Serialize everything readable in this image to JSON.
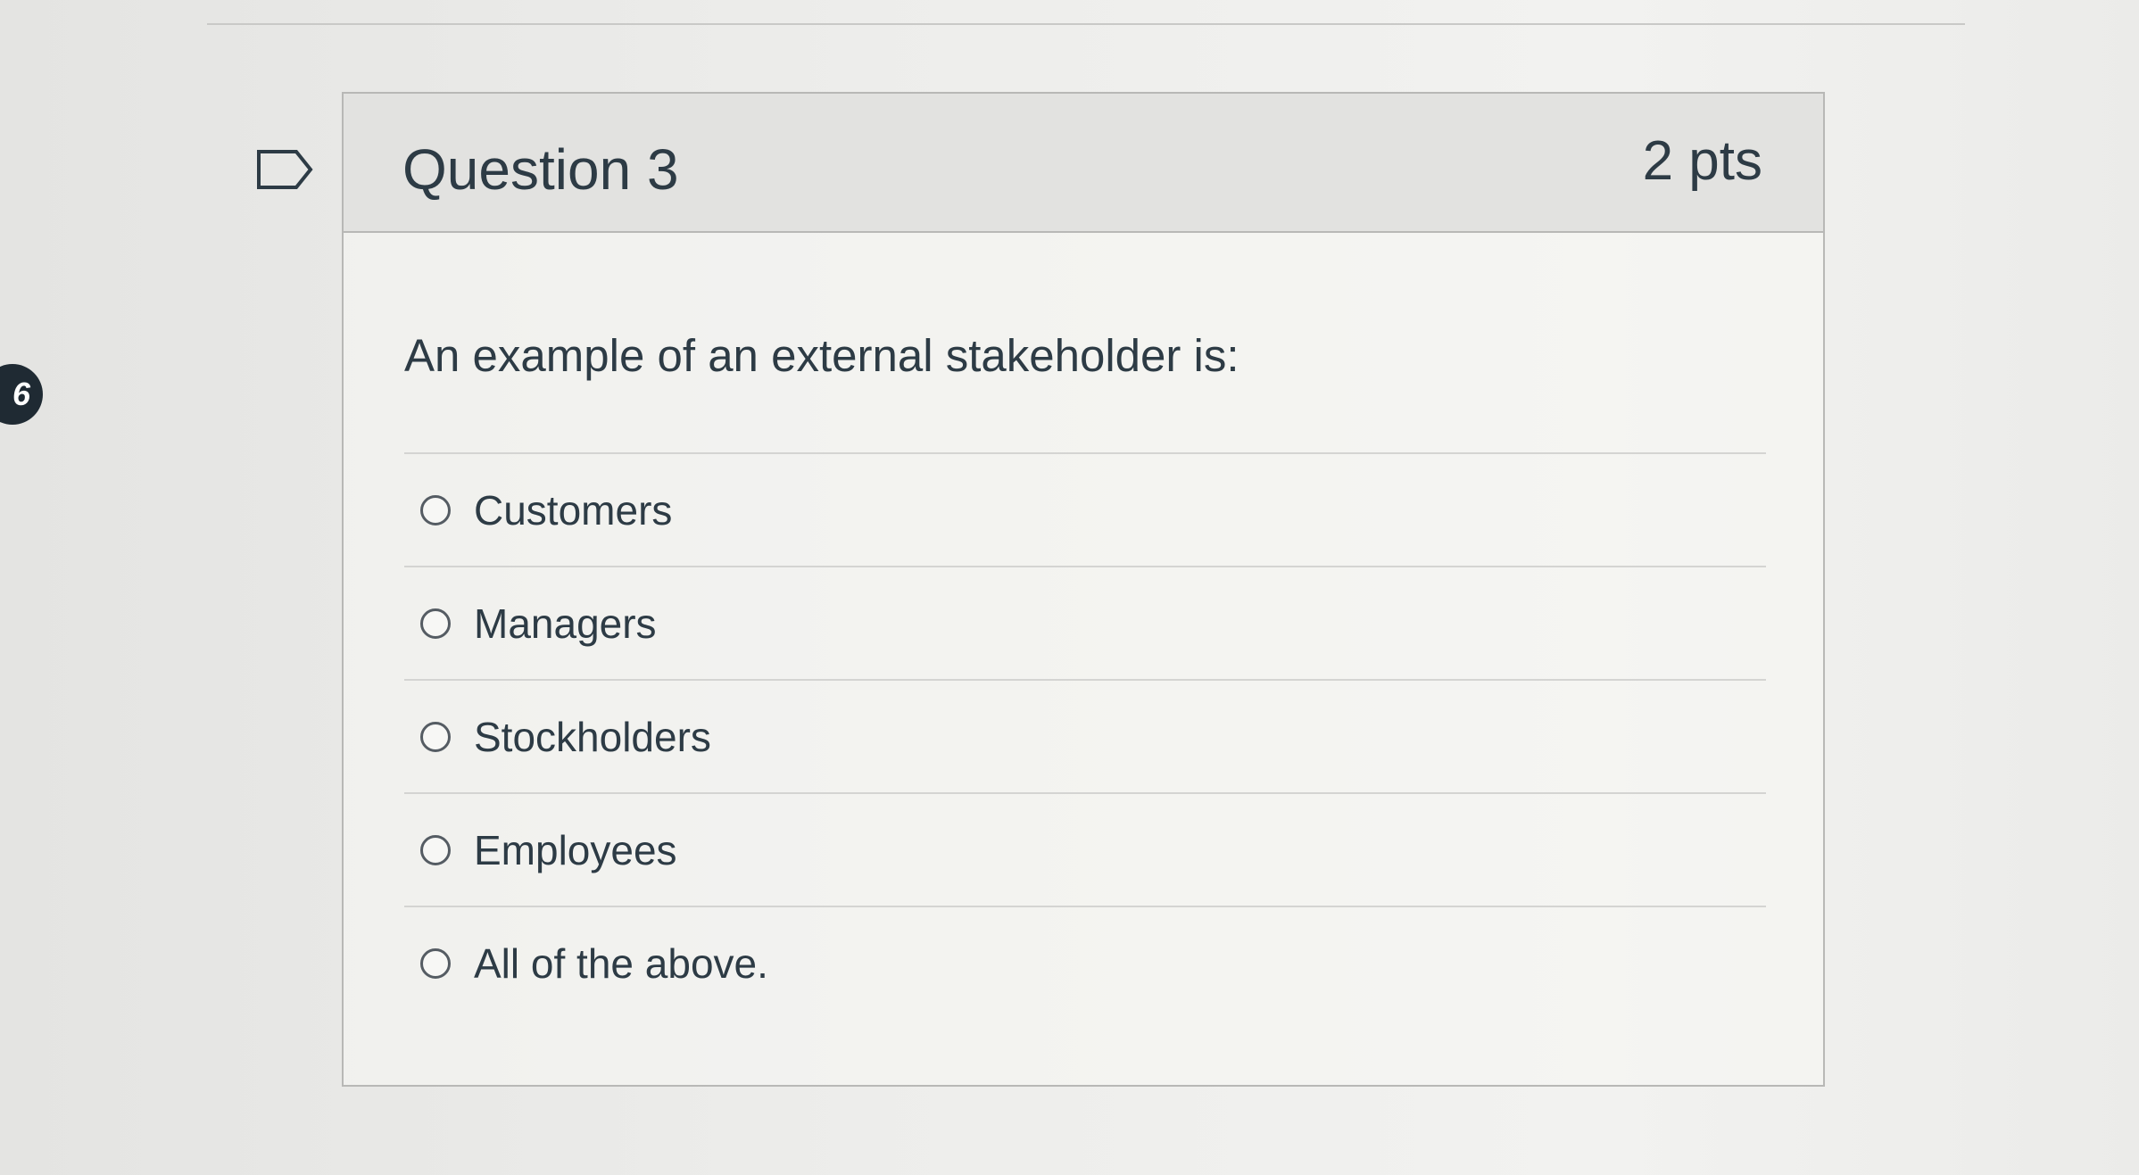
{
  "side_badge": "6",
  "question": {
    "title": "Question 3",
    "points": "2 pts",
    "text": "An example of an external stakeholder is:",
    "answers": [
      {
        "label": "Customers"
      },
      {
        "label": "Managers"
      },
      {
        "label": "Stockholders"
      },
      {
        "label": "Employees"
      },
      {
        "label": "All of the above."
      }
    ]
  },
  "icons": {
    "flag": "flag-question-icon"
  }
}
